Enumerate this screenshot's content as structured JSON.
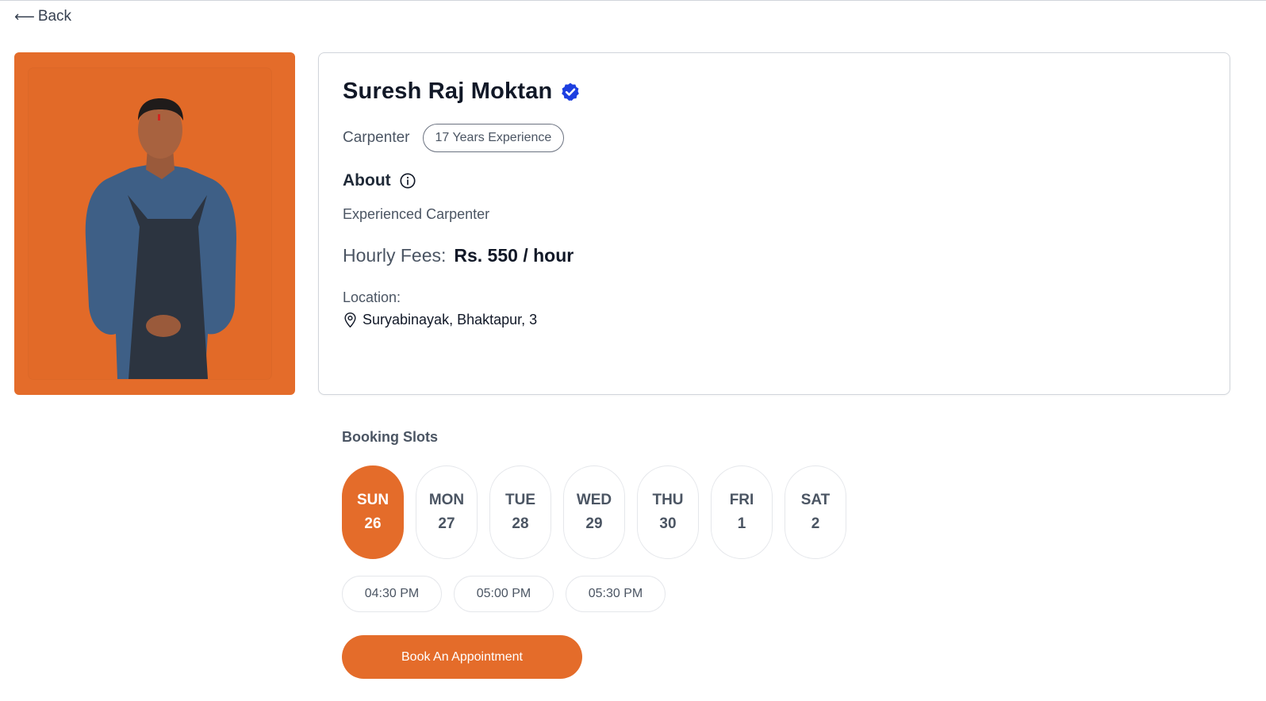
{
  "nav": {
    "back_label": "Back",
    "back_arrow": "⟵"
  },
  "profile": {
    "name": "Suresh Raj Moktan",
    "verified_icon": "verified-badge-icon",
    "profession": "Carpenter",
    "experience": "17 Years Experience",
    "about_title": "About",
    "about_text": "Experienced Carpenter",
    "fees_label": "Hourly Fees:",
    "fees_value": "Rs. 550 / hour",
    "location_label": "Location:",
    "location_value": "Suryabinayak, Bhaktapur, 3"
  },
  "booking": {
    "title": "Booking Slots",
    "days": [
      {
        "name": "SUN",
        "date": "26",
        "selected": true
      },
      {
        "name": "MON",
        "date": "27",
        "selected": false
      },
      {
        "name": "TUE",
        "date": "28",
        "selected": false
      },
      {
        "name": "WED",
        "date": "29",
        "selected": false
      },
      {
        "name": "THU",
        "date": "30",
        "selected": false
      },
      {
        "name": "FRI",
        "date": "1",
        "selected": false
      },
      {
        "name": "SAT",
        "date": "2",
        "selected": false
      }
    ],
    "times": [
      "04:30 PM",
      "05:00 PM",
      "05:30 PM"
    ],
    "book_label": "Book An Appointment"
  },
  "colors": {
    "accent": "#e46c2a",
    "verified": "#1d3fe0"
  }
}
